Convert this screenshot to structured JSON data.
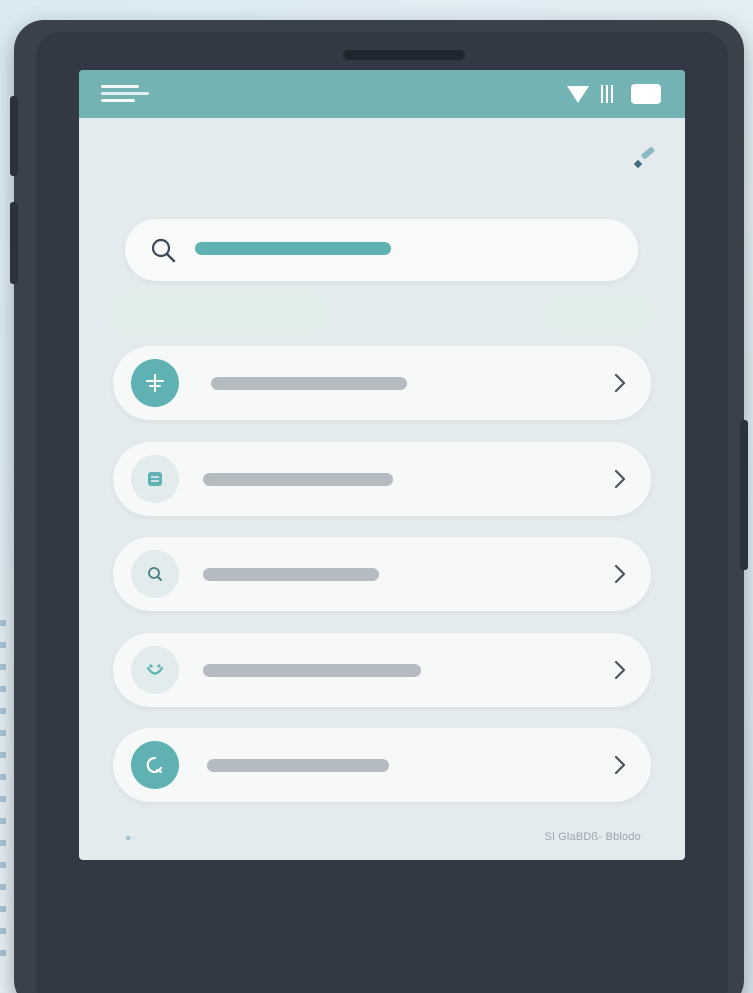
{
  "colors": {
    "accent": "#5fb1b2",
    "topbar": "#73b3b4",
    "screen": "#e4ebee",
    "device": "#3a414b",
    "placeholder_bar": "#b4bcc1"
  },
  "status_bar": {
    "icons": [
      "wifi-icon",
      "signal-icon",
      "battery-icon"
    ]
  },
  "header": {
    "menu_icon": "hamburger-menu-icon",
    "action_icon": "edit-icon"
  },
  "search": {
    "icon": "search-icon"
  },
  "list": {
    "items": [
      {
        "icon": "plus-icon",
        "icon_style": "teal"
      },
      {
        "icon": "document-icon",
        "icon_style": "pale"
      },
      {
        "icon": "search-icon",
        "icon_style": "pale"
      },
      {
        "icon": "face-icon",
        "icon_style": "pale"
      },
      {
        "icon": "circle-icon",
        "icon_style": "teal"
      }
    ]
  },
  "footer": {
    "text": "Sl GlaBDß- Bblodo"
  }
}
